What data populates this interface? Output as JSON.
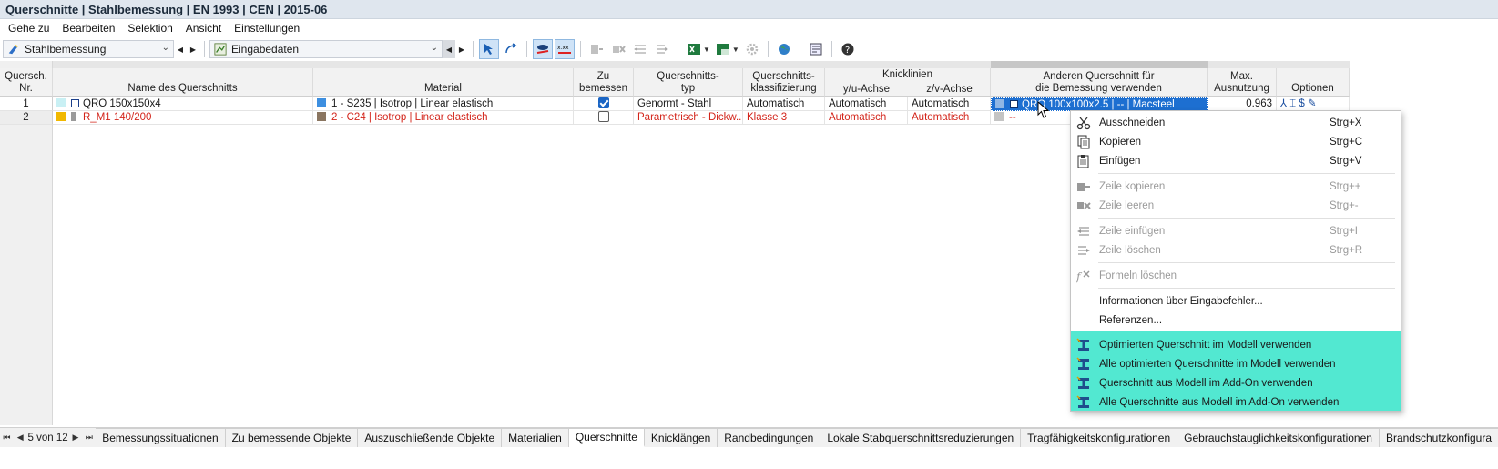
{
  "window": {
    "title": "Querschnitte | Stahlbemessung | EN 1993 | CEN | 2015-06"
  },
  "menu": [
    "Gehe zu",
    "Bearbeiten",
    "Selektion",
    "Ansicht",
    "Einstellungen"
  ],
  "toolbar": {
    "module_combo": "Stahlbemessung",
    "table_combo": "Eingabedaten"
  },
  "table": {
    "headers": {
      "nr": "Quersch.\nNr.",
      "name": "Name des Querschnitts",
      "material": "Material",
      "design": "Zu\nbemessen",
      "type": "Querschnitts-\ntyp",
      "class": "Querschnitts-\nklassifizierung",
      "buckling": "Knicklinien",
      "buckling_y": "y/u-Achse",
      "buckling_z": "z/v-Achse",
      "other": "Anderen Querschnitt für\ndie Bemessung verwenden",
      "max": "Max.\nAusnutzung",
      "options": "Optionen"
    },
    "rows": [
      {
        "nr": "1",
        "name": "QRO 150x150x4",
        "material": "1 - S235 | Isotrop | Linear elastisch",
        "design": true,
        "type": "Genormt - Stahl",
        "class": "Automatisch",
        "buckling_y": "Automatisch",
        "buckling_z": "Automatisch",
        "other": "QRO 100x100x2.5 | -- | Macsteel",
        "max": "0.963",
        "options": "⅄ ⌶ $ ✎"
      },
      {
        "nr": "2",
        "name": "R_M1 140/200",
        "material": "2 - C24 | Isotrop | Linear elastisch",
        "design": false,
        "type": "Parametrisch - Dickw...",
        "class": "Klasse 3",
        "buckling_y": "Automatisch",
        "buckling_z": "Automatisch",
        "other": "--",
        "max": "",
        "options": ""
      }
    ]
  },
  "context_menu": {
    "items": [
      {
        "label": "Ausschneiden",
        "shortcut": "Strg+X",
        "icon": "scissors-icon",
        "disabled": false
      },
      {
        "label": "Kopieren",
        "shortcut": "Strg+C",
        "icon": "copy-icon",
        "disabled": false
      },
      {
        "label": "Einfügen",
        "shortcut": "Strg+V",
        "icon": "paste-icon",
        "disabled": false
      },
      {
        "label": "Zeile kopieren",
        "shortcut": "Strg++",
        "icon": "copy-row-icon",
        "disabled": true
      },
      {
        "label": "Zeile leeren",
        "shortcut": "Strg+-",
        "icon": "clear-row-icon",
        "disabled": true
      },
      {
        "label": "Zeile einfügen",
        "shortcut": "Strg+I",
        "icon": "insert-row-icon",
        "disabled": true
      },
      {
        "label": "Zeile löschen",
        "shortcut": "Strg+R",
        "icon": "delete-row-icon",
        "disabled": true
      },
      {
        "label": "Formeln löschen",
        "shortcut": "",
        "icon": "formula-delete-icon",
        "disabled": true
      },
      {
        "label": "Informationen über Eingabefehler...",
        "shortcut": "",
        "icon": "",
        "disabled": false
      },
      {
        "label": "Referenzen...",
        "shortcut": "",
        "icon": "",
        "disabled": false
      },
      {
        "label": "Optimierten Querschnitt im Modell verwenden",
        "shortcut": "",
        "icon": "section-icon",
        "disabled": false
      },
      {
        "label": "Alle optimierten Querschnitte im Modell verwenden",
        "shortcut": "",
        "icon": "section-icon",
        "disabled": false
      },
      {
        "label": "Querschnitt aus Modell im Add-On verwenden",
        "shortcut": "",
        "icon": "section-icon",
        "disabled": false
      },
      {
        "label": "Alle Querschnitte aus Modell im Add-On verwenden",
        "shortcut": "",
        "icon": "section-icon",
        "disabled": false
      }
    ]
  },
  "tabs": {
    "page_indicator": "5 von 12",
    "items": [
      "Bemessungssituationen",
      "Zu bemessende Objekte",
      "Auszuschließende Objekte",
      "Materialien",
      "Querschnitte",
      "Knicklängen",
      "Randbedingungen",
      "Lokale Stabquerschnittsreduzierungen",
      "Tragfähigkeitskonfigurationen",
      "Gebrauchstauglichkeitskonfigurationen",
      "Brandschutzkonfigura"
    ],
    "active_index": 4
  },
  "colors": {
    "selection": "#1d6fd1",
    "highlight_menu": "#52e8d1",
    "error_red": "#d3241a",
    "material_1": "#3d8fe0",
    "material_2": "#8a7560",
    "section_1": "#c9f0f4",
    "section_2": "#f1b800"
  }
}
